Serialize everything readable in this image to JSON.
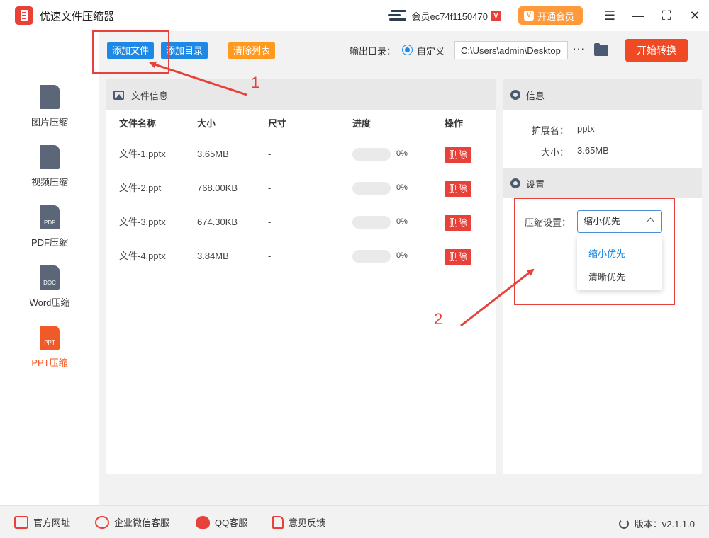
{
  "app": {
    "title": "优速文件压缩器"
  },
  "titlebar": {
    "member_name": "会员ec74f1150470",
    "vip_badge": "V",
    "open_vip_label": "开通会员",
    "open_vip_icon": "V"
  },
  "sidebar": {
    "items": [
      {
        "label": "图片压缩",
        "icon_text": "",
        "icon": "image-doc-icon"
      },
      {
        "label": "视频压缩",
        "icon_text": "",
        "icon": "video-doc-icon"
      },
      {
        "label": "PDF压缩",
        "icon_text": "PDF",
        "icon": "pdf-doc-icon"
      },
      {
        "label": "Word压缩",
        "icon_text": "DOC",
        "icon": "doc-icon"
      },
      {
        "label": "PPT压缩",
        "icon_text": "PPT",
        "icon": "ppt-doc-icon",
        "active": true
      }
    ]
  },
  "toolbar": {
    "add_file": "添加文件",
    "add_dir": "添加目录",
    "clear_list": "清除列表",
    "output_label": "输出目录：",
    "radio_label": "自定义",
    "output_path": "C:\\Users\\admin\\Desktop",
    "more": "···",
    "start": "开始转换"
  },
  "file_panel": {
    "title": "文件信息",
    "columns": [
      "文件名称",
      "大小",
      "尺寸",
      "进度",
      "操作"
    ],
    "rows": [
      {
        "name": "文件-1.pptx",
        "size": "3.65MB",
        "dim": "-",
        "progress": 0,
        "pct": "0%",
        "action": "删除"
      },
      {
        "name": "文件-2.ppt",
        "size": "768.00KB",
        "dim": "-",
        "progress": 0,
        "pct": "0%",
        "action": "删除"
      },
      {
        "name": "文件-3.pptx",
        "size": "674.30KB",
        "dim": "-",
        "progress": 0,
        "pct": "0%",
        "action": "删除"
      },
      {
        "name": "文件-4.pptx",
        "size": "3.84MB",
        "dim": "-",
        "progress": 0,
        "pct": "0%",
        "action": "删除"
      }
    ]
  },
  "info_panel": {
    "title": "信息",
    "ext_label": "扩展名：",
    "ext_value": "pptx",
    "size_label": "大小：",
    "size_value": "3.65MB",
    "settings_title": "设置",
    "compress_label": "压缩设置：",
    "compress_value": "缩小优先",
    "options": [
      "缩小优先",
      "清晰优先"
    ]
  },
  "annotations": {
    "num1": "1",
    "num2": "2"
  },
  "footer": {
    "website": "官方网址",
    "wechat": "企业微信客服",
    "qq": "QQ客服",
    "feedback": "意见反馈",
    "version": "版本：v2.1.1.0"
  },
  "colors": {
    "accent": "#f04a24",
    "primary_blue": "#1e88e5",
    "orange": "#ff9a3c",
    "annotation": "#e8413a"
  }
}
